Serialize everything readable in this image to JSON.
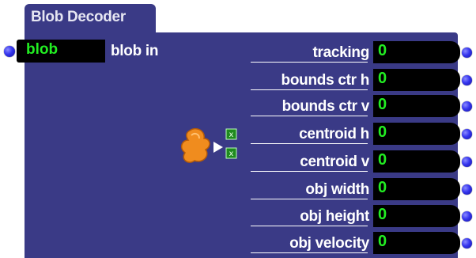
{
  "actor": {
    "title": "Blob Decoder",
    "inlet": {
      "value": "blob",
      "label": "blob in"
    },
    "outputs": [
      {
        "label": "tracking",
        "value": "0"
      },
      {
        "label": "bounds ctr h",
        "value": "0"
      },
      {
        "label": "bounds ctr v",
        "value": "0"
      },
      {
        "label": "centroid h",
        "value": "0"
      },
      {
        "label": "centroid v",
        "value": "0"
      },
      {
        "label": "obj width",
        "value": "0"
      },
      {
        "label": "obj height",
        "value": "0"
      },
      {
        "label": "obj velocity",
        "value": "0"
      }
    ],
    "icon": "blob-decoder-icon"
  },
  "colors": {
    "actor_body": "#3a3a86",
    "field_bg": "#000000",
    "field_text": "#22ee22",
    "label_text": "#ffffff",
    "port_dot": "#3434ee",
    "blob_orange": "#f08c1e"
  }
}
